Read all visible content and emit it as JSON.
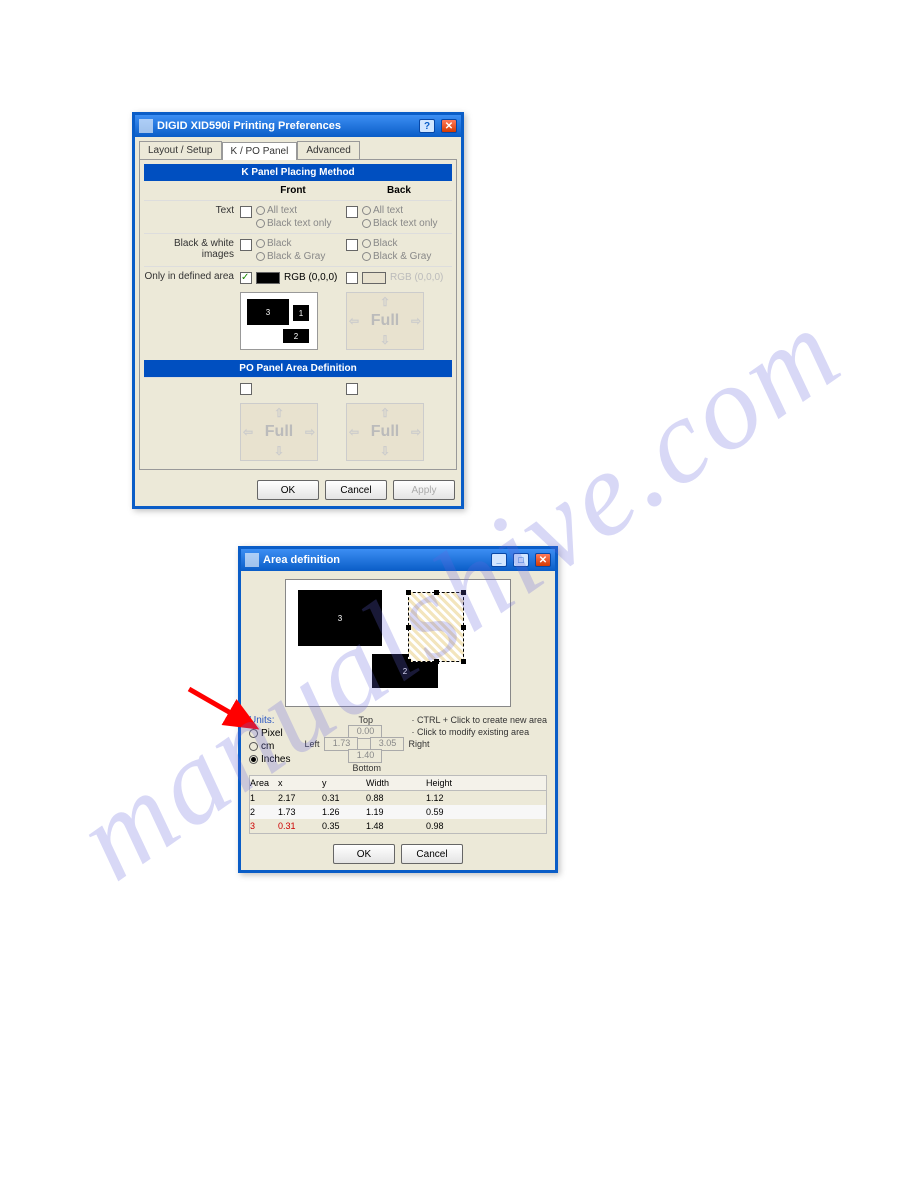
{
  "dialog1": {
    "title": "DIGID XID590i Printing Preferences",
    "tabs": [
      "Layout / Setup",
      "K / PO Panel",
      "Advanced"
    ],
    "active_tab": 1,
    "section_k": "K Panel Placing Method",
    "col_front": "Front",
    "col_back": "Back",
    "row_text_label": "Text",
    "opt_all_text": "All text",
    "opt_black_text": "Black text only",
    "row_bw_label": "Black & white images",
    "opt_black": "Black",
    "opt_black_gray": "Black & Gray",
    "row_defined_label": "Only in defined area",
    "rgb_label": "RGB (0,0,0)",
    "full_label": "Full",
    "section_po": "PO Panel Area Definition",
    "btn_ok": "OK",
    "btn_cancel": "Cancel",
    "btn_apply": "Apply"
  },
  "dialog2": {
    "title": "Area definition",
    "units_label": "Units:",
    "opt_pixel": "Pixel",
    "opt_cm": "cm",
    "opt_inch": "Inches",
    "top": "Top",
    "left": "Left",
    "right": "Right",
    "bottom": "Bottom",
    "top_val": "0.00",
    "left_val": "1.73",
    "right_val": "3.05",
    "bottom_val": "1.40",
    "hint1": "· CTRL + Click to create new area",
    "hint2": "· Click to modify existing area",
    "hdr_area": "Area",
    "hdr_x": "x",
    "hdr_y": "y",
    "hdr_w": "Width",
    "hdr_h": "Height",
    "rows": [
      {
        "a": "1",
        "x": "2.17",
        "y": "0.31",
        "w": "0.88",
        "h": "1.12"
      },
      {
        "a": "2",
        "x": "1.73",
        "y": "1.26",
        "w": "1.19",
        "h": "0.59"
      },
      {
        "a": "3",
        "x": "0.31",
        "y": "0.35",
        "w": "1.48",
        "h": "0.98"
      }
    ],
    "btn_ok": "OK",
    "btn_cancel": "Cancel"
  }
}
